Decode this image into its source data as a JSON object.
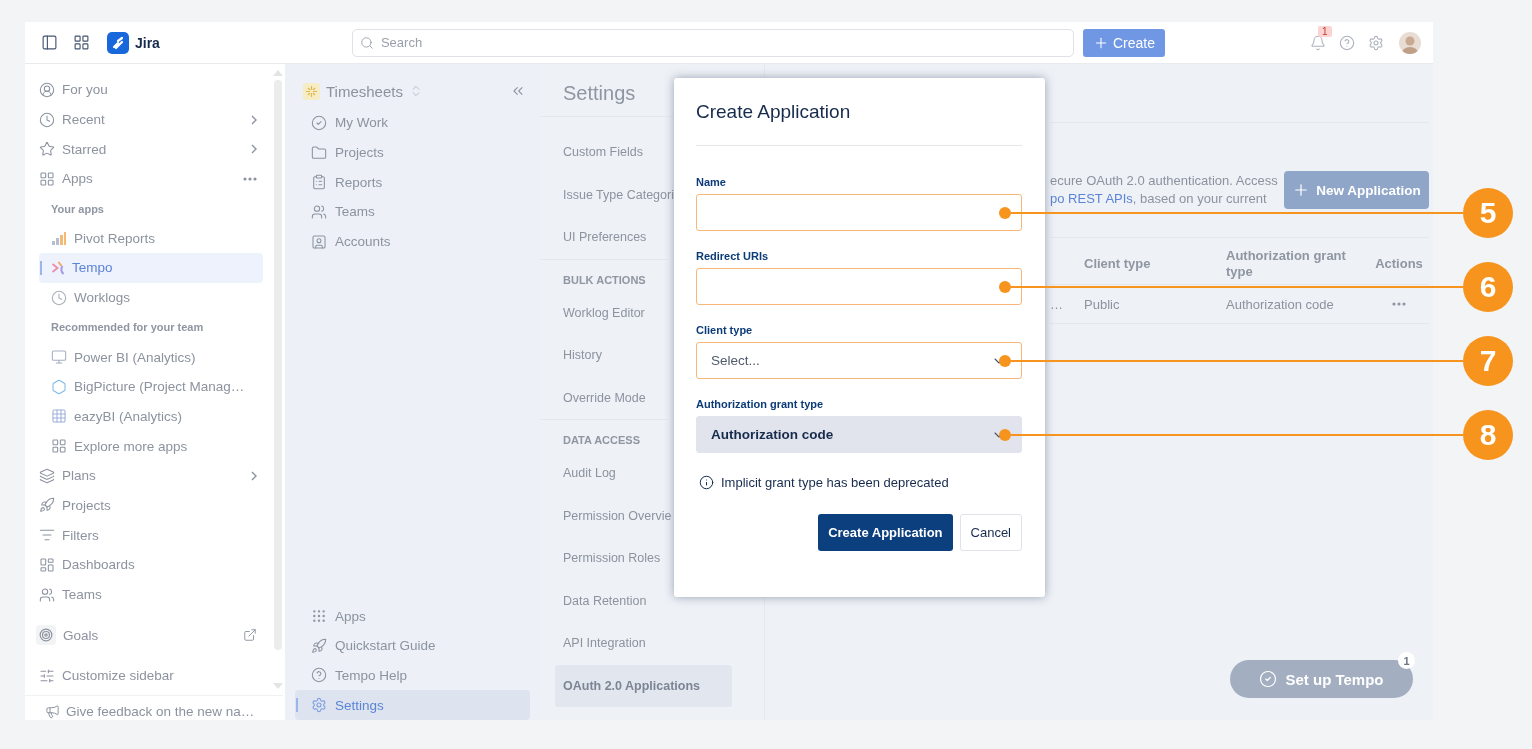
{
  "topbar": {
    "product": "Jira",
    "search": {
      "placeholder": "Search"
    },
    "create_button": "Create",
    "notifications_badge": "1"
  },
  "sidebar": {
    "items": [
      {
        "label": "For you",
        "kind": "item",
        "chevron": false,
        "selected": false
      },
      {
        "label": "Recent",
        "kind": "item",
        "chevron": true,
        "selected": false
      },
      {
        "label": "Starred",
        "kind": "item",
        "chevron": true,
        "selected": false
      },
      {
        "label": "Apps",
        "kind": "item",
        "chevron": false,
        "more": true,
        "selected": false,
        "children": [
          {
            "label": "Your apps",
            "kind": "heading"
          },
          {
            "label": "Pivot Reports",
            "kind": "app",
            "selected": false
          },
          {
            "label": "Tempo",
            "kind": "app",
            "selected": true
          },
          {
            "label": "Worklogs",
            "kind": "app",
            "selected": false
          },
          {
            "label": "Recommended for your team",
            "kind": "heading"
          },
          {
            "label": "Power BI (Analytics)",
            "kind": "app",
            "selected": false
          },
          {
            "label": "BigPicture (Project Manag…",
            "kind": "app",
            "selected": false
          },
          {
            "label": "eazyBI (Analytics)",
            "kind": "app",
            "selected": false
          },
          {
            "label": "Explore more apps",
            "kind": "app",
            "selected": false
          }
        ]
      },
      {
        "label": "Plans",
        "kind": "item",
        "chevron": true,
        "selected": false
      },
      {
        "label": "Projects",
        "kind": "item",
        "chevron": false,
        "selected": false
      },
      {
        "label": "Filters",
        "kind": "item",
        "chevron": false,
        "selected": false
      },
      {
        "label": "Dashboards",
        "kind": "item",
        "chevron": false,
        "selected": false
      },
      {
        "label": "Teams",
        "kind": "item",
        "chevron": false,
        "selected": false
      },
      {
        "label": "Goals",
        "kind": "boxed",
        "chevron": false,
        "external": true,
        "selected": false
      },
      {
        "label": "Customize sidebar",
        "kind": "item",
        "chevron": false,
        "selected": false
      }
    ],
    "feedback": "Give feedback on the new na…"
  },
  "timesheets": {
    "title": "Timesheets",
    "items": [
      {
        "label": "My Work",
        "selected": false
      },
      {
        "label": "Projects",
        "selected": false
      },
      {
        "label": "Reports",
        "selected": false
      },
      {
        "label": "Teams",
        "selected": false
      },
      {
        "label": "Accounts",
        "selected": false
      }
    ],
    "footer_items": [
      {
        "label": "Apps",
        "selected": false
      },
      {
        "label": "Quickstart Guide",
        "selected": false
      },
      {
        "label": "Tempo Help",
        "selected": false
      },
      {
        "label": "Settings",
        "selected": true
      }
    ]
  },
  "settings_nav": {
    "title": "Settings",
    "groups": [
      {
        "items": [
          {
            "label": "Custom Fields",
            "selected": false
          },
          {
            "label": "Issue Type Categori",
            "selected": false
          },
          {
            "label": "UI Preferences",
            "selected": false
          }
        ]
      },
      {
        "heading": "BULK ACTIONS",
        "items": [
          {
            "label": "Worklog Editor",
            "selected": false
          },
          {
            "label": "History",
            "selected": false
          },
          {
            "label": "Override Mode",
            "selected": false
          }
        ]
      },
      {
        "heading": "DATA ACCESS",
        "items": [
          {
            "label": "Audit Log",
            "selected": false
          },
          {
            "label": "Permission Overvie",
            "selected": false
          },
          {
            "label": "Permission Roles",
            "selected": false
          },
          {
            "label": "Data Retention",
            "selected": false
          },
          {
            "label": "API Integration",
            "selected": false
          },
          {
            "label": "OAuth 2.0 Applications",
            "selected": true
          }
        ]
      }
    ]
  },
  "main": {
    "description": {
      "line_1": "ecure OAuth 2.0 authentication. Access",
      "link": "po REST APIs",
      "line_2_rest": ", based on your current"
    },
    "new_application_button": "New Application",
    "table": {
      "columns": [
        "Client type",
        "Authorization grant type",
        "Actions"
      ],
      "rows": [
        {
          "column_1": "…",
          "client_type": "Public",
          "grant_type": "Authorization code"
        }
      ]
    },
    "setup_button": {
      "label": "Set up Tempo",
      "badge": "1"
    }
  },
  "dialog": {
    "title": "Create Application",
    "fields": [
      {
        "label": "Name",
        "kind": "text",
        "highlighted": true,
        "disabled": false,
        "callout": "5"
      },
      {
        "label": "Redirect URIs",
        "kind": "text",
        "highlighted": true,
        "disabled": false,
        "callout": "6"
      },
      {
        "label": "Client type",
        "kind": "select",
        "placeholder": "Select...",
        "highlighted": true,
        "disabled": false,
        "callout": "7"
      },
      {
        "label": "Authorization grant type",
        "kind": "select",
        "value": "Authorization code",
        "highlighted": false,
        "disabled": true,
        "callout": "8"
      }
    ],
    "note": "Implicit grant type has been deprecated",
    "buttons": [
      {
        "label": "Create Application",
        "kind": "primary"
      },
      {
        "label": "Cancel",
        "kind": "secondary"
      }
    ]
  }
}
